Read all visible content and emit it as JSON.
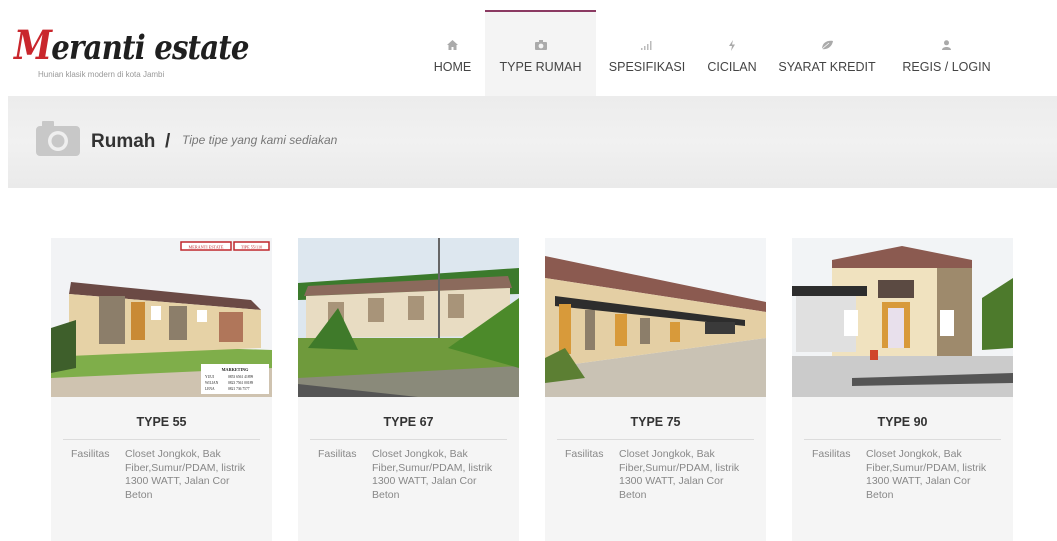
{
  "logo": {
    "title_initial": "M",
    "title_rest": "eranti estate",
    "tagline": "Hunian klasik modern di kota Jambi"
  },
  "nav": [
    {
      "label": "HOME",
      "icon": "home-icon",
      "active": false
    },
    {
      "label": "TYPE RUMAH",
      "icon": "camera-icon",
      "active": true
    },
    {
      "label": "SPESIFIKASI",
      "icon": "signal-icon",
      "active": false
    },
    {
      "label": "CICILAN",
      "icon": "bolt-icon",
      "active": false
    },
    {
      "label": "SYARAT KREDIT",
      "icon": "leaf-icon",
      "active": false
    },
    {
      "label": "REGIS / LOGIN",
      "icon": "user-icon",
      "active": false
    }
  ],
  "banner": {
    "title": "Rumah",
    "separator": "/",
    "subtitle": "Tipe tipe yang kami sediakan"
  },
  "cards": [
    {
      "title": "TYPE 55",
      "spec_key": "Fasilitas",
      "spec_value": "Closet Jongkok, Bak Fiber,Sumur/PDAM, listrik 1300 WATT, Jalan Cor Beton",
      "photo_tags": [
        "MERANTI ESTATE",
        "TIPE 55/110"
      ],
      "photo_marketing": {
        "title": "MARKETING",
        "rows": [
          [
            "YUUI",
            "0853 6561 41899"
          ],
          [
            "WILIAN",
            "0823 7561 00189"
          ],
          [
            "LENA",
            "0821 736 7577"
          ]
        ]
      }
    },
    {
      "title": "TYPE 67",
      "spec_key": "Fasilitas",
      "spec_value": "Closet Jongkok, Bak Fiber,Sumur/PDAM, listrik 1300 WATT, Jalan Cor Beton"
    },
    {
      "title": "TYPE 75",
      "spec_key": "Fasilitas",
      "spec_value": "Closet Jongkok, Bak Fiber,Sumur/PDAM, listrik 1300 WATT, Jalan Cor Beton"
    },
    {
      "title": "TYPE 90",
      "spec_key": "Fasilitas",
      "spec_value": "Closet Jongkok, Bak Fiber,Sumur/PDAM, listrik 1300 WATT, Jalan Cor Beton"
    }
  ],
  "colors": {
    "accent": "#8b3a62",
    "logo_red": "#c9262c",
    "card_bg": "#f5f5f5"
  }
}
